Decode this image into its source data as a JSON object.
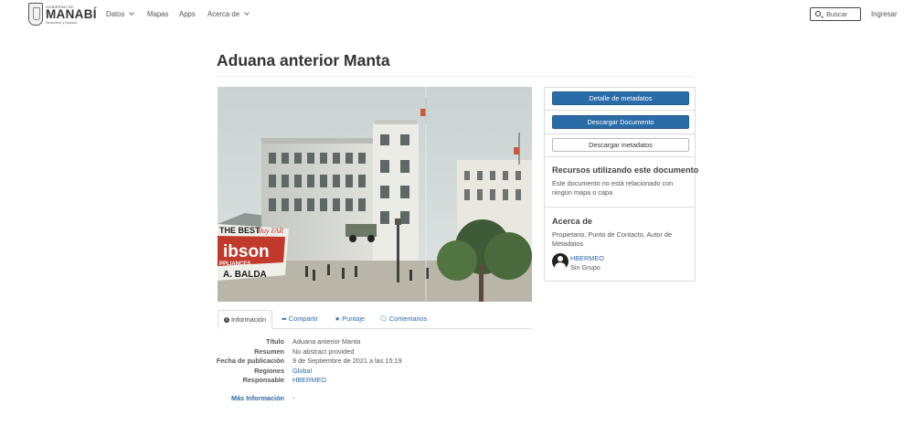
{
  "header": {
    "logo": {
      "top_text": "GOBIERNO DE",
      "name": "MANABÍ",
      "tagline": "Dinamismo y Equidad"
    },
    "nav": [
      {
        "label": "Datos",
        "dropdown": true
      },
      {
        "label": "Mapas",
        "dropdown": false
      },
      {
        "label": "Apps",
        "dropdown": false
      },
      {
        "label": "Acerca de",
        "dropdown": true
      }
    ],
    "search": {
      "placeholder": "Buscar",
      "value": ""
    },
    "login_label": "Ingresar"
  },
  "page": {
    "title": "Aduana anterior Manta"
  },
  "image": {
    "alt": "Aduana anterior Manta",
    "sign_text": [
      "THE BEST",
      "Buy FAR",
      "ibson",
      "PPLIANCES",
      "A. BALDA"
    ]
  },
  "tabs": [
    {
      "label": "Información",
      "icon": "info-circle-icon",
      "active": true
    },
    {
      "label": "Compartir",
      "icon": "share-icon",
      "active": false
    },
    {
      "label": "Puntaje",
      "icon": "star-icon",
      "active": false
    },
    {
      "label": "Comentarios",
      "icon": "comment-icon",
      "active": false
    }
  ],
  "metadata": [
    {
      "key": "Título",
      "value": "Aduana anterior Manta",
      "link": false
    },
    {
      "key": "Resumen",
      "value": "No abstract provided",
      "link": false
    },
    {
      "key": "Fecha de publicación",
      "value": "9 de Septiembre de 2021 a las 15:19",
      "link": false
    },
    {
      "key": "Regiones",
      "value": "Global",
      "link": true
    },
    {
      "key": "Responsable",
      "value": "HBERMEO",
      "link": true
    }
  ],
  "more_info": {
    "label": "Más Información",
    "value": "-"
  },
  "sidebar": {
    "buttons": {
      "detail": "Detalle de metadatos",
      "download_doc": "Descargar Documento",
      "download_meta": "Descargar metadatos"
    },
    "resources": {
      "heading": "Recursos utilizando este documento",
      "text": "Este documento no está relacionado con ningún mapa o capa"
    },
    "about": {
      "heading": "Acerca de",
      "roles": "Propietario, Punto de Contacto, Autor de Metadatos",
      "owner": "HBERMEO",
      "group": "Sin Grupo"
    }
  },
  "colors": {
    "primary": "#2a6ca8",
    "link": "#2a6aad",
    "text": "#333333"
  }
}
